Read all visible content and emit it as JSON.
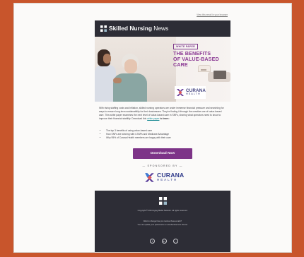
{
  "view_online": "View this email in your browser",
  "header": {
    "brand_bold": "Skilled Nursing",
    "brand_light": "News",
    "logo_icon": "skilled-nursing-logo-icon"
  },
  "hero": {
    "tag": "WHITE PAPER",
    "title_line1": "THE BENEFITS",
    "title_line2": "OF VALUE-BASED",
    "title_line3": "CARE",
    "badge_name": "CURANA",
    "badge_sub": "HEALTH"
  },
  "body": {
    "paragraph_before_link": "With rising staffing costs and inflation, skilled nursing operators are under immense financial pressure and searching for ways to ensure long-term sustainability for their businesses. They're finding it through the creative use of value-based care. This white paper examines the next level of value-based care in SNFs, sharing what operators need to know to improve their financial stability. Download this",
    "link_text": "white paper",
    "paragraph_after_link": "to learn:",
    "bullets": [
      "The top 3 benefits of using value-based care",
      "How SNFs are winning with I-SNPs and Medicare Advantage",
      "Why 95% of Curana Health members are happy with their care"
    ]
  },
  "cta": {
    "download_label": "Download Now"
  },
  "sponsor": {
    "label": "— SPONSORED BY —",
    "name": "CURANA",
    "sub": "HEALTH"
  },
  "footer": {
    "copyright": "Copyright © 2024 Aging Media Network. All rights reserved.",
    "manage_line1": "Want to change how you receive these emails?",
    "manage_line2": "You can update your preferences or unsubscribe from this list.",
    "socials": [
      {
        "icon": "facebook-icon",
        "glyph": "f"
      },
      {
        "icon": "linkedin-icon",
        "glyph": "in"
      },
      {
        "icon": "web-icon",
        "glyph": "◌"
      }
    ]
  },
  "colors": {
    "background": "#c8552c",
    "header": "#2d2d36",
    "accent": "#7d3488",
    "link": "#1a8a94"
  }
}
